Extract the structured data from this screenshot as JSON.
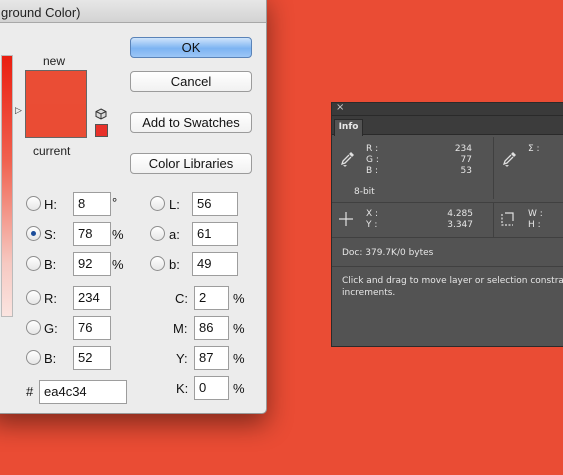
{
  "dialog": {
    "title": "ground Color)",
    "new_label": "new",
    "current_label": "current",
    "buttons": {
      "ok": "OK",
      "cancel": "Cancel",
      "add_swatches": "Add to Swatches",
      "color_libraries": "Color Libraries"
    },
    "hsb": [
      {
        "label": "H:",
        "value": "8",
        "unit": "°",
        "checked": false
      },
      {
        "label": "S:",
        "value": "78",
        "unit": "%",
        "checked": true
      },
      {
        "label": "B:",
        "value": "92",
        "unit": "%",
        "checked": false
      }
    ],
    "rgb": [
      {
        "label": "R:",
        "value": "234"
      },
      {
        "label": "G:",
        "value": "76"
      },
      {
        "label": "B:",
        "value": "52"
      }
    ],
    "lab": [
      {
        "label": "L:",
        "value": "56"
      },
      {
        "label": "a:",
        "value": "61"
      },
      {
        "label": "b:",
        "value": "49"
      }
    ],
    "cmyk": [
      {
        "label": "C:",
        "value": "2",
        "unit": "%"
      },
      {
        "label": "M:",
        "value": "86",
        "unit": "%"
      },
      {
        "label": "Y:",
        "value": "87",
        "unit": "%"
      },
      {
        "label": "K:",
        "value": "0",
        "unit": "%"
      }
    ],
    "hex_label": "#",
    "hex_value": "ea4c34",
    "colors": {
      "new": "#ea4d35",
      "current": "#ea4c34"
    }
  },
  "info_panel": {
    "close": "×",
    "tab": "Info",
    "rgb_labels": {
      "r": "R :",
      "g": "G :",
      "b": "B :"
    },
    "rgb_values": {
      "r": "234",
      "g": "77",
      "b": "53"
    },
    "sigma_label": "Σ :",
    "bit_depth": "8-bit",
    "xy_labels": {
      "x": "X :",
      "y": "Y :"
    },
    "xy_values": {
      "x": "4.285",
      "y": "3.347"
    },
    "wh_labels": {
      "w": "W :",
      "h": "H :"
    },
    "doc": "Doc: 379.7K/0 bytes",
    "hint_line1": "Click and drag to move layer or selection constrain",
    "hint_line2": "increments."
  },
  "background_color": "#ea4c34"
}
